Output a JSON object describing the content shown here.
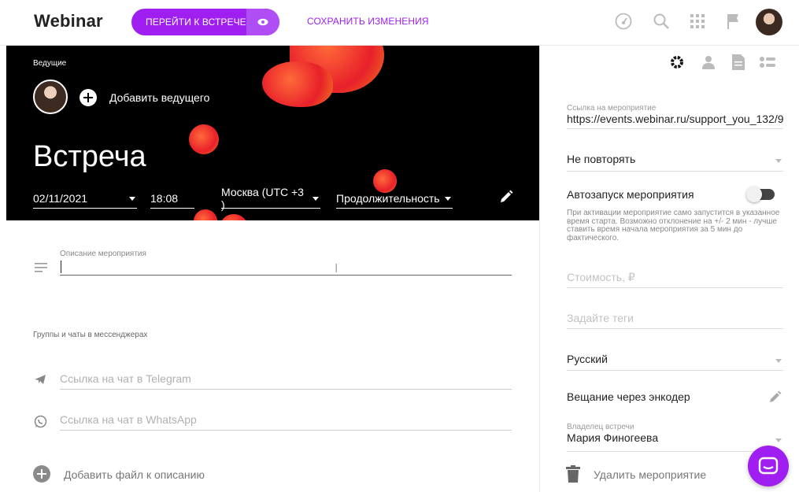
{
  "header": {
    "logo": "Webinar",
    "go_button": "ПЕРЕЙТИ К ВСТРЕЧЕ",
    "save_link": "СОХРАНИТЬ ИЗМЕНЕНИЯ",
    "icons": [
      "dashboard-icon",
      "search-icon",
      "apps-grid-icon",
      "flag-icon",
      "avatar"
    ]
  },
  "hero": {
    "hosts_label": "Ведущие",
    "add_host": "Добавить ведущего",
    "title": "Встреча",
    "date": "02/11/2021",
    "time": "18:08",
    "timezone": "Москва (UTC +3 )",
    "duration": "Продолжительность"
  },
  "description": {
    "label": "Описание мероприятия",
    "value": ""
  },
  "groups": {
    "label": "Группы и чаты в мессенджерах",
    "telegram_placeholder": "Ссылка на чат в Telegram",
    "whatsapp_placeholder": "Ссылка на чат в WhatsApp"
  },
  "add_file": "Добавить файл к описанию",
  "right_panel": {
    "tabs": [
      "settings-icon",
      "person-icon",
      "document-icon",
      "layout-icon"
    ],
    "event_link_label": "Ссылка на мероприятие",
    "event_link_value": "https://events.webinar.ru/support_you_132/9",
    "repeat": "Не повторять",
    "autostart_label": "Автозапуск мероприятия",
    "autostart_note": "При активации мероприятие само запустится в указанное время старта. Возможно отклонение на +/- 2 мин - лучше ставить время начала мероприятия за 5 мин до фактического.",
    "price_placeholder": "Стоимость, ₽",
    "tags_placeholder": "Задайте теги",
    "language": "Русский",
    "encoder_label": "Вещание через энкодер",
    "owner_label": "Владелец встречи",
    "owner_value": "Мария Финогеева",
    "delete_label": "Удалить мероприятие"
  },
  "colors": {
    "accent": "#9f1ff0",
    "hero_bg": "#000000",
    "blob": "#e8202a"
  }
}
